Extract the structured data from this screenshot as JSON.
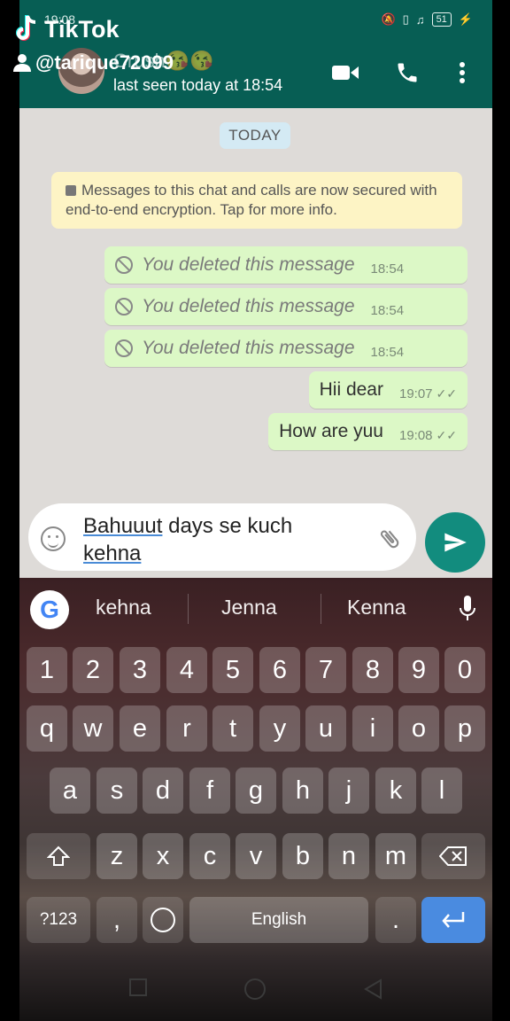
{
  "status_bar": {
    "time": "19:08",
    "battery": "51"
  },
  "header": {
    "contact_name": "Crush😘😘",
    "last_seen": "last seen today at 18:54",
    "icons": [
      "video-call-icon",
      "phone-icon",
      "more-vert-icon"
    ]
  },
  "chat": {
    "date_label": "TODAY",
    "encryption_notice": "Messages to this chat and calls are now secured with end-to-end encryption. Tap for more info.",
    "messages": [
      {
        "text": "You deleted this message",
        "time": "18:54",
        "deleted": true
      },
      {
        "text": "You deleted this message",
        "time": "18:54",
        "deleted": true
      },
      {
        "text": "You deleted this message",
        "time": "18:54",
        "deleted": true
      },
      {
        "text": "Hii dear",
        "time": "19:07",
        "ticks": "✓✓"
      },
      {
        "text": "How are yuu",
        "time": "19:08",
        "ticks": "✓✓"
      }
    ]
  },
  "composer": {
    "text_underlined": "Bahuuut",
    "text_rest": " days se kuch",
    "text_line2": "kehna"
  },
  "keyboard": {
    "suggestions": [
      "kehna",
      "Jenna",
      "Kenna"
    ],
    "row_numbers": [
      "1",
      "2",
      "3",
      "4",
      "5",
      "6",
      "7",
      "8",
      "9",
      "0"
    ],
    "row_top": [
      "q",
      "w",
      "e",
      "r",
      "t",
      "y",
      "u",
      "i",
      "o",
      "p"
    ],
    "row_mid": [
      "a",
      "s",
      "d",
      "f",
      "g",
      "h",
      "j",
      "k",
      "l"
    ],
    "row_bottom": [
      "z",
      "x",
      "c",
      "v",
      "b",
      "n",
      "m"
    ],
    "symbols_label": "?123",
    "comma": ",",
    "space_label": "English",
    "period": "."
  },
  "overlay": {
    "brand": "TikTok",
    "username": "@tarique72099"
  },
  "colors": {
    "header": "#075e54",
    "bubble_out": "#dcf8c6",
    "send_button": "#128c7e",
    "enter_key": "#4a8be0"
  }
}
